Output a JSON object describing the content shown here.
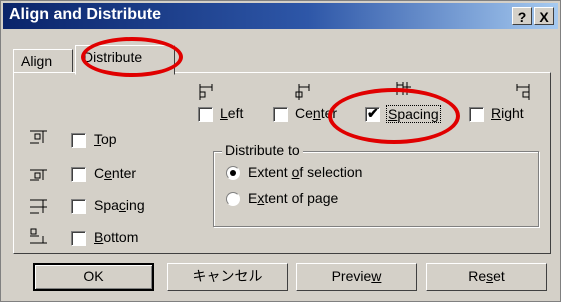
{
  "window": {
    "title": "Align and Distribute",
    "help_label": "?",
    "close_label": "X"
  },
  "tabs": [
    {
      "label": "Align",
      "active": false
    },
    {
      "label": "Distribute",
      "active": true
    }
  ],
  "horizontal": [
    {
      "label": "Left",
      "mnemonic": "L",
      "rest": "eft",
      "checked": false,
      "icon": "distribute-left-icon"
    },
    {
      "label": "Center",
      "mnemonic": "n",
      "pre": "Ce",
      "rest": "ter",
      "checked": false,
      "icon": "distribute-center-h-icon"
    },
    {
      "label": "Spacing",
      "mnemonic": "S",
      "rest": "pacing",
      "checked": true,
      "icon": "distribute-spacing-h-icon"
    },
    {
      "label": "Right",
      "mnemonic": "R",
      "rest": "ight",
      "checked": false,
      "icon": "distribute-right-icon"
    }
  ],
  "vertical": [
    {
      "label": "Top",
      "mnemonic": "T",
      "pre": "",
      "rest": "op",
      "checked": false,
      "icon": "distribute-top-icon"
    },
    {
      "label": "Center",
      "mnemonic": "e",
      "pre": "C",
      "rest": "nter",
      "checked": false,
      "icon": "distribute-center-v-icon"
    },
    {
      "label": "Spacing",
      "mnemonic": "c",
      "pre": "Spa",
      "rest": "ing",
      "checked": false,
      "icon": "distribute-spacing-v-icon"
    },
    {
      "label": "Bottom",
      "mnemonic": "B",
      "pre": "",
      "rest": "ottom",
      "checked": false,
      "icon": "distribute-bottom-icon"
    }
  ],
  "distribute_to": {
    "title": "Distribute to",
    "options": [
      {
        "pre": "Extent ",
        "mnemonic": "o",
        "rest": "f selection",
        "selected": true
      },
      {
        "pre": "E",
        "mnemonic": "x",
        "rest": "tent of page",
        "selected": false
      }
    ]
  },
  "buttons": {
    "ok": "OK",
    "cancel": "キャンセル",
    "preview_pre": "Previe",
    "preview_mn": "w",
    "preview_rest": "",
    "reset_pre": "Re",
    "reset_mn": "s",
    "reset_rest": "et"
  },
  "colors": {
    "highlight_ring": "#e00000",
    "titlebar_start": "#0a246a",
    "titlebar_end": "#a6caf0"
  }
}
